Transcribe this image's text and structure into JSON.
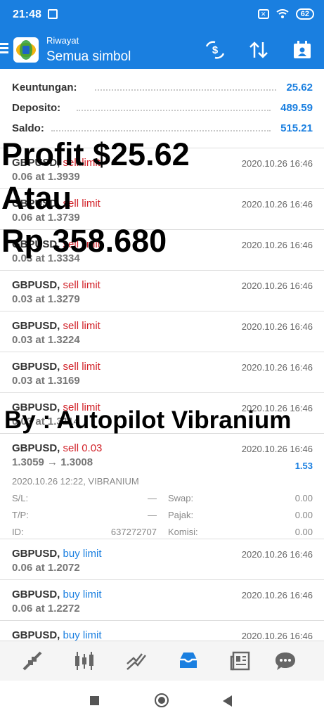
{
  "status_bar": {
    "time": "21:48",
    "battery": "62"
  },
  "app_bar": {
    "subtitle": "Riwayat",
    "title": "Semua simbol"
  },
  "summary": {
    "profit_label": "Keuntungan:",
    "profit_value": "25.62",
    "deposit_label": "Deposito:",
    "deposit_value": "489.59",
    "balance_label": "Saldo:",
    "balance_value": "515.21"
  },
  "orders": [
    {
      "symbol": "GBPUSD,",
      "type": "sell limit",
      "side": "sell",
      "detail": "0.06 at 1.3939",
      "date": "2020.10.26 16:46"
    },
    {
      "symbol": "GBPUSD,",
      "type": "sell limit",
      "side": "sell",
      "detail": "0.06 at 1.3739",
      "date": "2020.10.26 16:46"
    },
    {
      "symbol": "GBPUSD,",
      "type": "sell limit",
      "side": "sell",
      "detail": "0.03 at 1.3334",
      "date": "2020.10.26 16:46"
    },
    {
      "symbol": "GBPUSD,",
      "type": "sell limit",
      "side": "sell",
      "detail": "0.03 at 1.3279",
      "date": "2020.10.26 16:46"
    },
    {
      "symbol": "GBPUSD,",
      "type": "sell limit",
      "side": "sell",
      "detail": "0.03 at 1.3224",
      "date": "2020.10.26 16:46"
    },
    {
      "symbol": "GBPUSD,",
      "type": "sell limit",
      "side": "sell",
      "detail": "0.03 at 1.3169",
      "date": "2020.10.26 16:46"
    },
    {
      "symbol": "GBPUSD,",
      "type": "sell limit",
      "side": "sell",
      "detail": "0.03 at 1.3114",
      "date": "2020.10.26 16:46"
    }
  ],
  "deal": {
    "symbol": "GBPUSD,",
    "type": "sell 0.03",
    "detail": "1.3059 → 1.3008",
    "date": "2020.10.26 16:46",
    "profit": "1.53",
    "open_info": "2020.10.26 12:22, VIBRANIUM",
    "sl_label": "S/L:",
    "sl_value": "—",
    "tp_label": "T/P:",
    "tp_value": "—",
    "id_label": "ID:",
    "id_value": "637272707",
    "swap_label": "Swap:",
    "swap_value": "0.00",
    "tax_label": "Pajak:",
    "tax_value": "0.00",
    "commission_label": "Komisi:",
    "commission_value": "0.00"
  },
  "orders_after": [
    {
      "symbol": "GBPUSD,",
      "type": "buy limit",
      "side": "buy",
      "detail": "0.06 at 1.2072",
      "date": "2020.10.26 16:46"
    },
    {
      "symbol": "GBPUSD,",
      "type": "buy limit",
      "side": "buy",
      "detail": "0.06 at 1.2272",
      "date": "2020.10.26 16:46"
    },
    {
      "symbol": "GBPUSD,",
      "type": "buy limit",
      "side": "buy",
      "detail": "",
      "date": "2020.10.26 16:46"
    }
  ],
  "overlay": {
    "line1": "Profit $25.62",
    "line2": "Atau",
    "line3": "Rp 358.680",
    "line4": "By : Autopilot Vibranium"
  },
  "colors": {
    "accent": "#1a7fe0",
    "sell": "#d2232a",
    "buy": "#1a7fe0"
  },
  "bottom_nav": [
    "quotes-icon",
    "chart-icon",
    "trade-icon",
    "history-icon",
    "news-icon",
    "chat-icon"
  ]
}
